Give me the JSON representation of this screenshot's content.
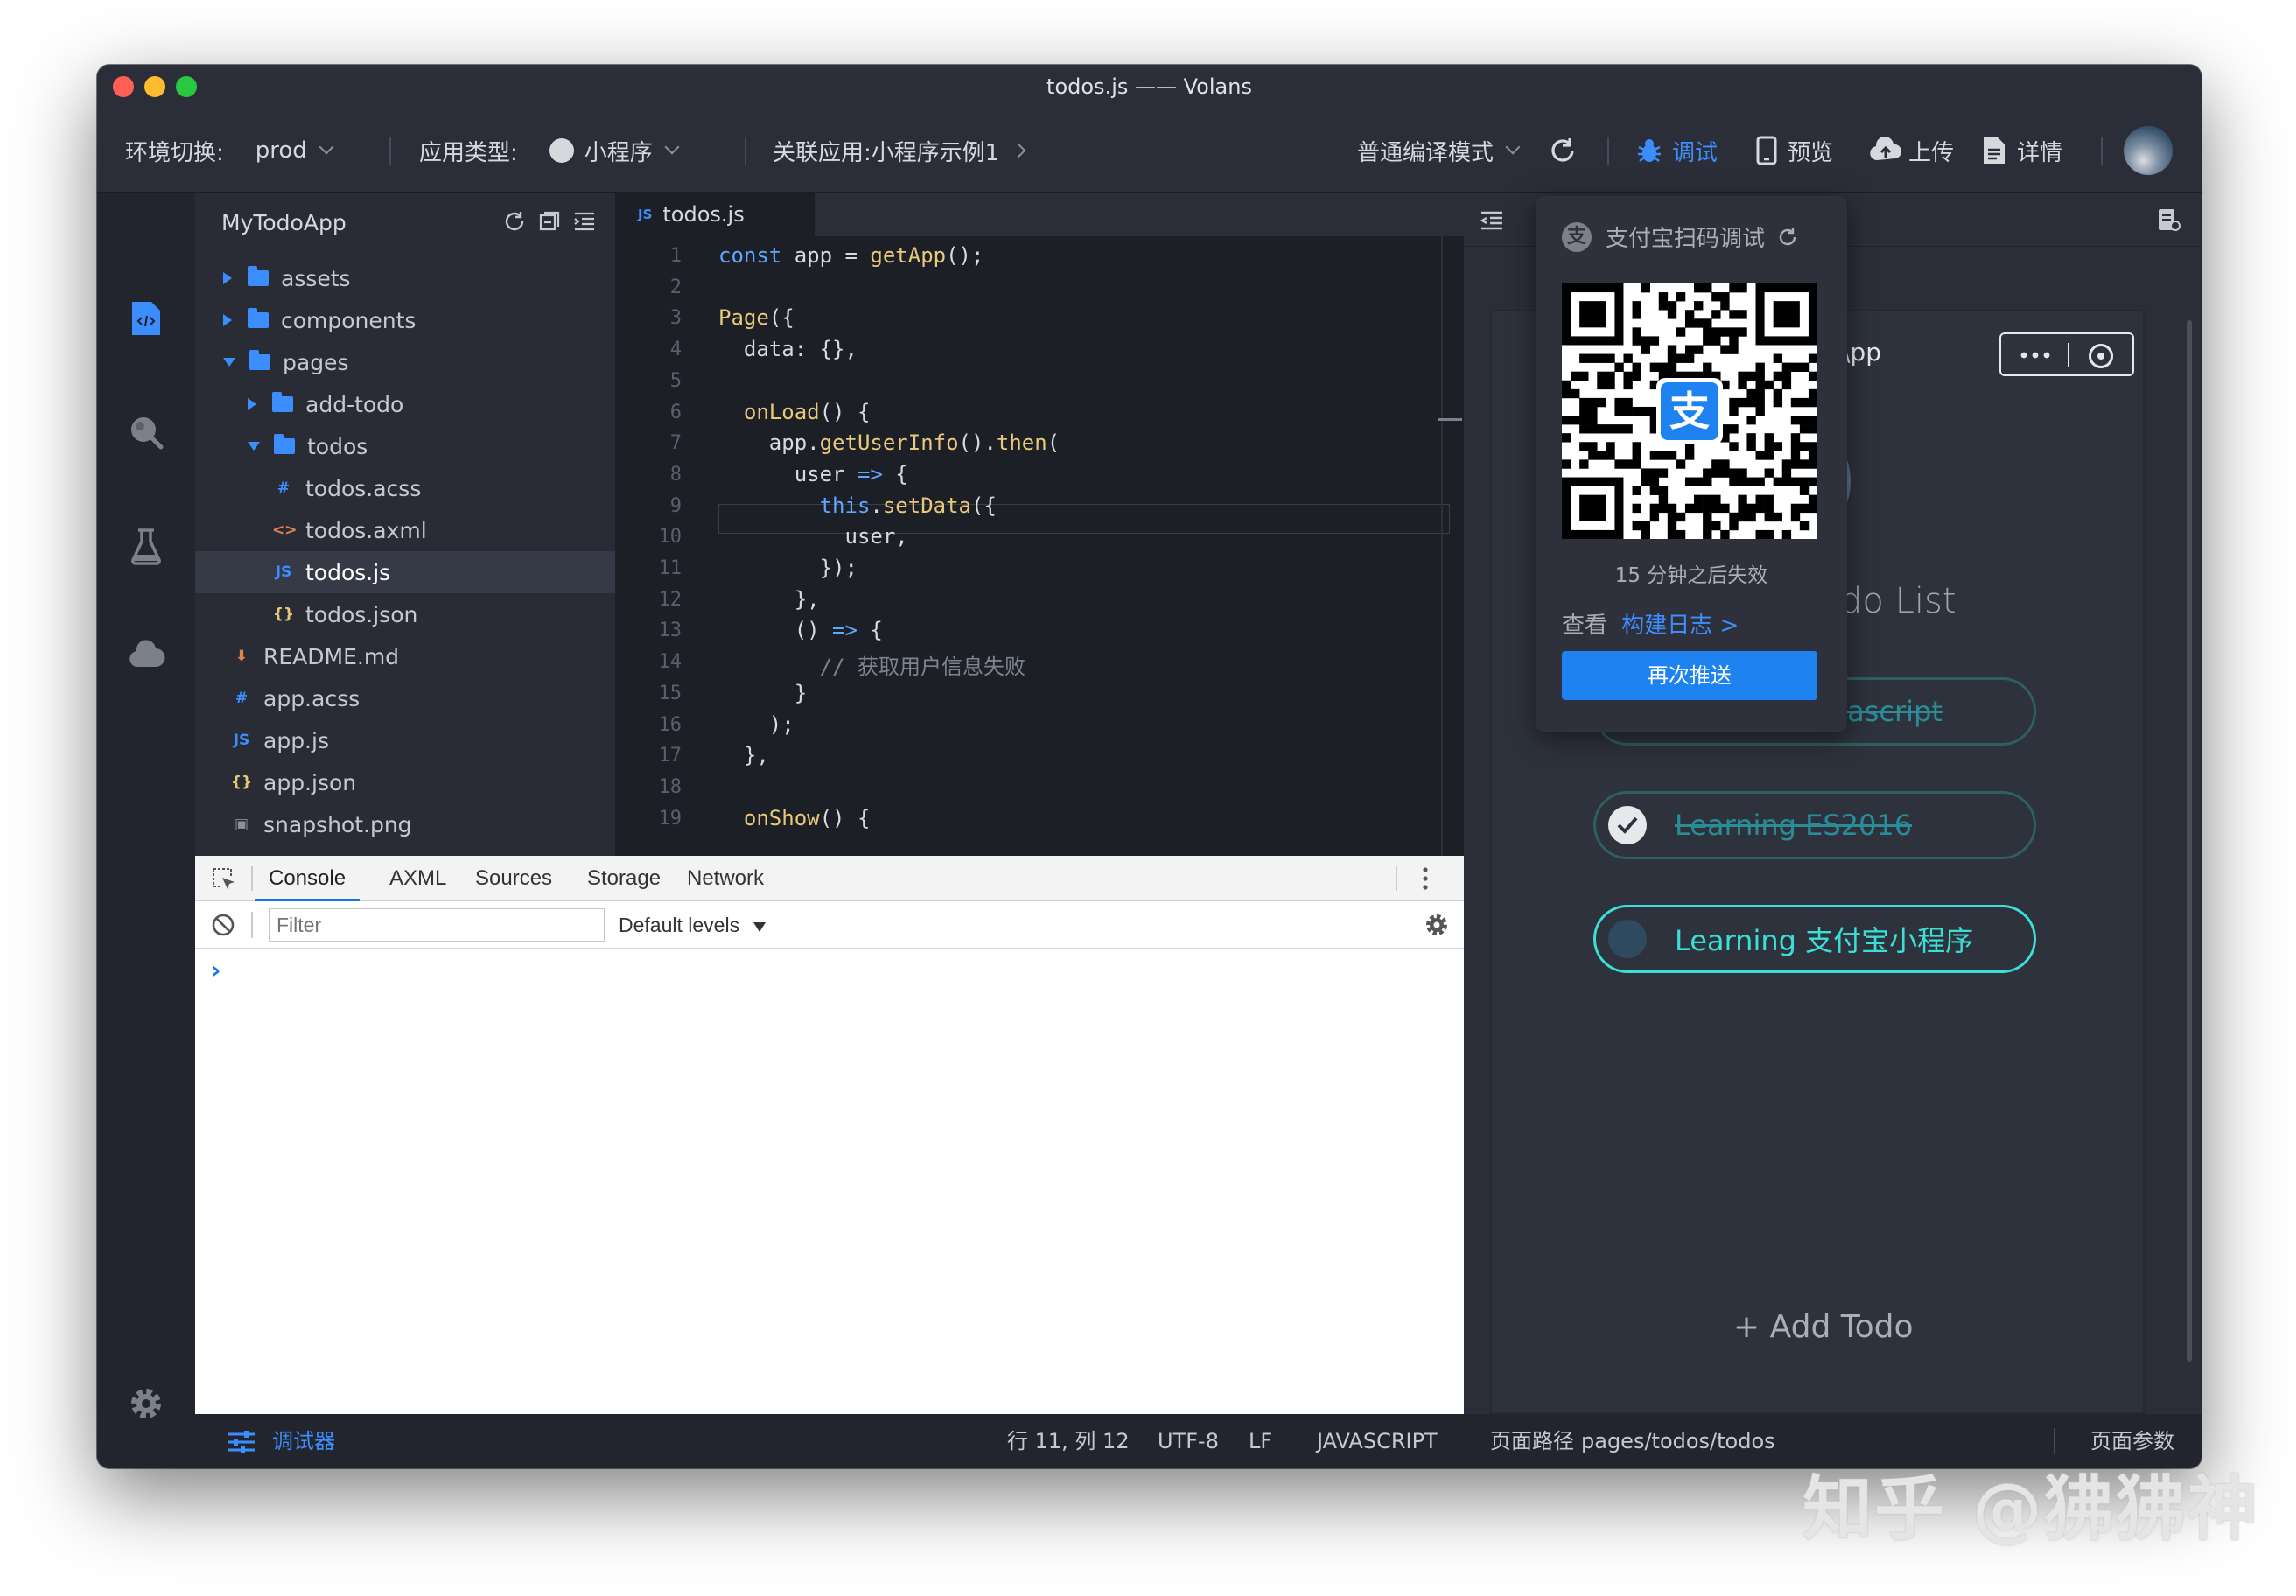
{
  "window": {
    "title": "todos.js —— Volans"
  },
  "toolbar": {
    "env_label": "环境切换:",
    "env_value": "prod",
    "apptype_label": "应用类型:",
    "apptype_value": "小程序",
    "linked_app_label": "关联应用:",
    "linked_app_value": "小程序示例1",
    "compile_mode": "普通编译模式",
    "debug_label": "调试",
    "preview_label": "预览",
    "upload_label": "上传",
    "details_label": "详情"
  },
  "activity_bar": {
    "icons": [
      "code-icon",
      "search-icon",
      "flask-icon",
      "cloud-icon",
      "gear-icon"
    ]
  },
  "explorer": {
    "project_name": "MyTodoApp",
    "items": [
      {
        "label": "assets",
        "type": "folder",
        "level": 0,
        "open": false
      },
      {
        "label": "components",
        "type": "folder",
        "level": 0,
        "open": false
      },
      {
        "label": "pages",
        "type": "folder",
        "level": 0,
        "open": true
      },
      {
        "label": "add-todo",
        "type": "folder",
        "level": 1,
        "open": false
      },
      {
        "label": "todos",
        "type": "folder",
        "level": 1,
        "open": true
      },
      {
        "label": "todos.acss",
        "type": "acss",
        "level": 2
      },
      {
        "label": "todos.axml",
        "type": "axml",
        "level": 2
      },
      {
        "label": "todos.js",
        "type": "js",
        "level": 2,
        "selected": true
      },
      {
        "label": "todos.json",
        "type": "json",
        "level": 2
      },
      {
        "label": "README.md",
        "type": "md",
        "level": 0
      },
      {
        "label": "app.acss",
        "type": "acss",
        "level": 0
      },
      {
        "label": "app.js",
        "type": "js",
        "level": 0
      },
      {
        "label": "app.json",
        "type": "json",
        "level": 0
      },
      {
        "label": "snapshot.png",
        "type": "png",
        "level": 0
      }
    ]
  },
  "editor": {
    "tab_label": "todos.js",
    "lines": [
      "const app = getApp();",
      "",
      "Page({",
      "  data: {},",
      "",
      "  onLoad() {",
      "    app.getUserInfo().then(",
      "      user => {",
      "        this.setData({",
      "          user,",
      "        });",
      "      },",
      "      () => {",
      "        // 获取用户信息失败",
      "      }",
      "    );",
      "  },",
      "",
      "  onShow() {"
    ]
  },
  "devtools": {
    "tabs": [
      "Console",
      "AXML",
      "Sources",
      "Storage",
      "Network"
    ],
    "active_tab": "Console",
    "filter_placeholder": "Filter",
    "levels": "Default levels",
    "prompt": "›"
  },
  "statusbar": {
    "debugger_label": "调试器",
    "cursor": "行 11, 列 12",
    "encoding": "UTF-8",
    "eol": "LF",
    "language": "JAVASCRIPT",
    "page_path_label": "页面路径",
    "page_path": "pages/todos/todos",
    "page_params": "页面参数"
  },
  "simulator": {
    "title_partial": "\\pp",
    "list_title_partial": "do List",
    "todos": [
      {
        "text": "Learning Javascript",
        "done": true
      },
      {
        "text": "Learning ES2016",
        "done": true
      },
      {
        "text": "Learning 支付宝小程序",
        "done": false
      }
    ],
    "add_todo": "+ Add Todo"
  },
  "popup": {
    "title": "支付宝扫码调试",
    "expire_text": "15 分钟之后失效",
    "view_label": "查看",
    "build_log_link": "构建日志 >",
    "push_again": "再次推送"
  },
  "watermark": "知乎 @狒狒神",
  "colors": {
    "accent": "#3c8eff",
    "teal": "#3ae0d6",
    "push": "#1e82f0"
  }
}
